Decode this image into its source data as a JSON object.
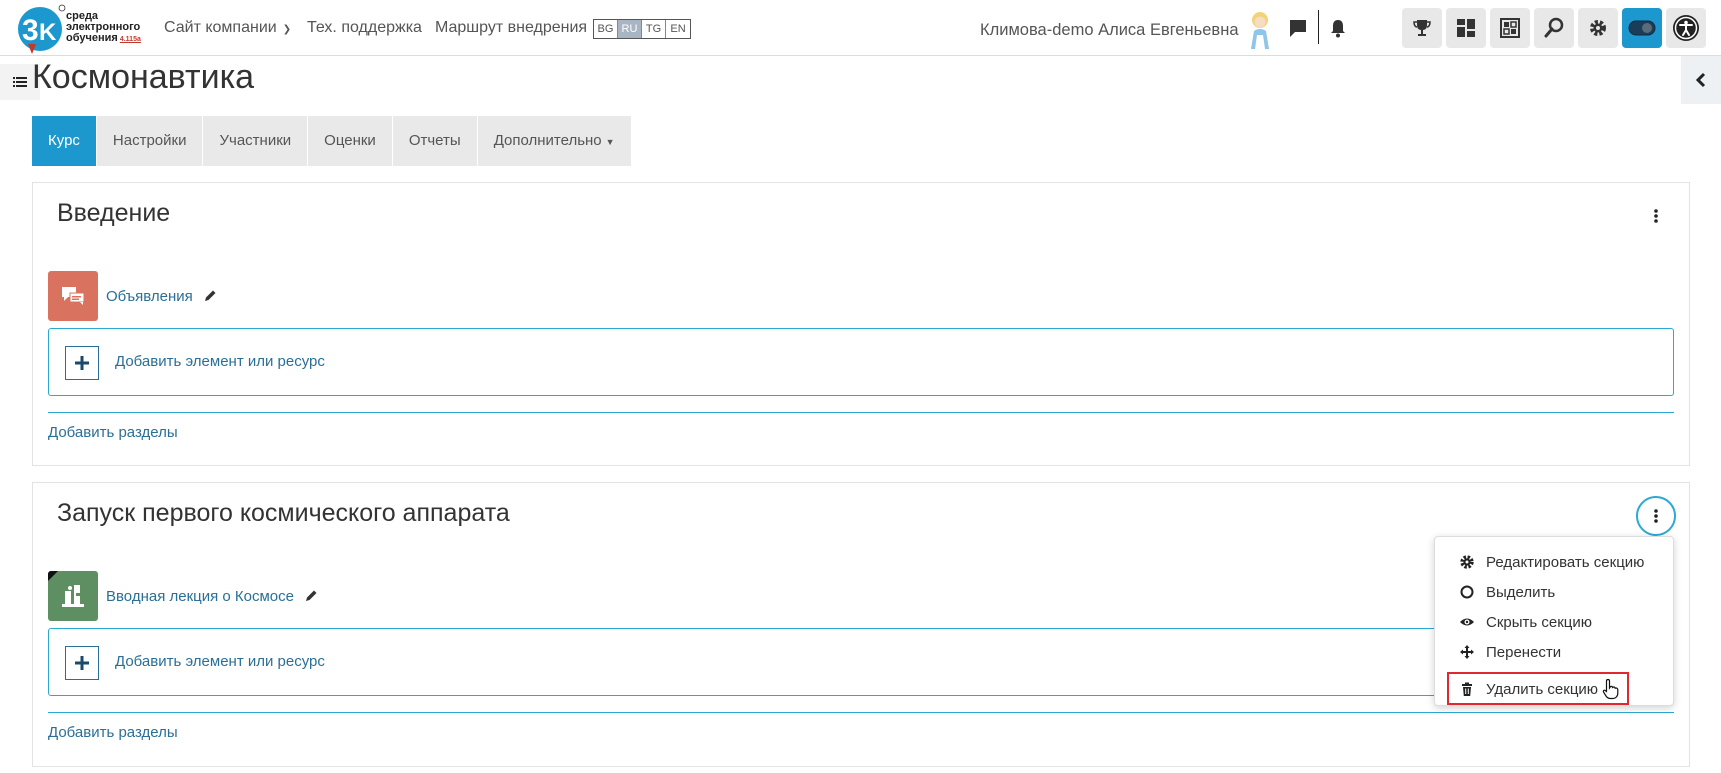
{
  "header": {
    "logo_text": [
      "среда",
      "электронного",
      "обучения"
    ],
    "logo_version": "4.115a",
    "nav": {
      "company_site": "Сайт компании",
      "support": "Тех. поддержка",
      "route": "Маршрут внедрения"
    },
    "languages": [
      "BG",
      "RU",
      "TG",
      "EN"
    ],
    "active_language": "RU",
    "user_name": "Климова-demo Алиса Евгеньевна"
  },
  "page": {
    "title": "Космонавтика"
  },
  "tabs": [
    {
      "label": "Курс"
    },
    {
      "label": "Настройки"
    },
    {
      "label": "Участники"
    },
    {
      "label": "Оценки"
    },
    {
      "label": "Отчеты"
    },
    {
      "label": "Дополнительно"
    }
  ],
  "sections": [
    {
      "title": "Введение",
      "activity_name": "Объявления",
      "add_activity_label": "Добавить элемент или ресурс",
      "add_sections_label": "Добавить разделы"
    },
    {
      "title": "Запуск первого космического аппарата",
      "activity_name": "Вводная лекция о Космосе",
      "add_activity_label": "Добавить элемент или ресурс",
      "add_sections_label": "Добавить разделы"
    }
  ],
  "section_menu": [
    {
      "label": "Редактировать секцию",
      "icon": "gear-icon"
    },
    {
      "label": "Выделить",
      "icon": "circle-icon"
    },
    {
      "label": "Скрыть секцию",
      "icon": "eye-icon"
    },
    {
      "label": "Перенести",
      "icon": "move-icon"
    },
    {
      "label": "Удалить секцию",
      "icon": "trash-icon"
    }
  ],
  "colors": {
    "accent": "#1d98cf",
    "link": "#2a6f97",
    "forum_icon": "#d9735f",
    "lecture_icon": "#5e8f62",
    "highlight_border": "#e0282e"
  }
}
